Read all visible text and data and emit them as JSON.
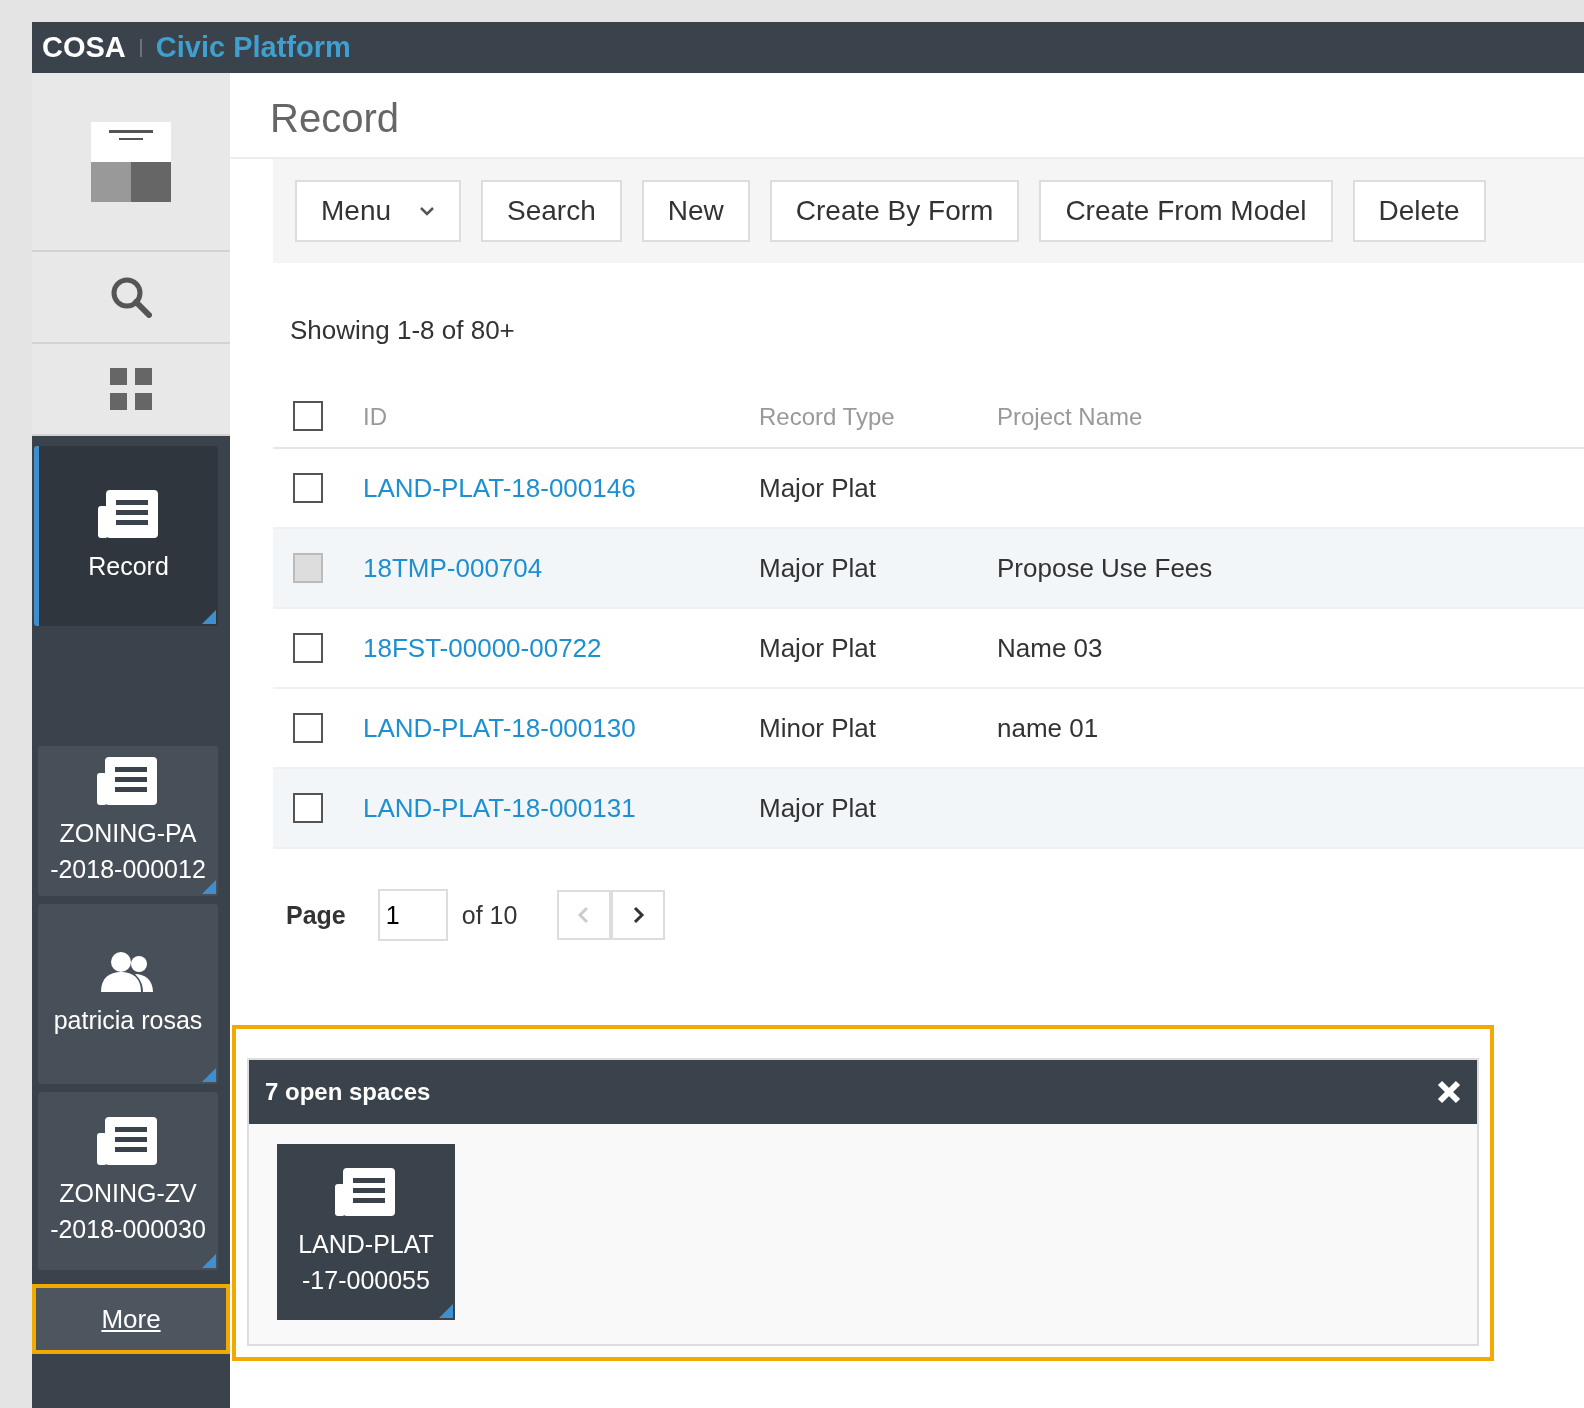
{
  "header": {
    "brand": "COSA",
    "product": "Civic Platform"
  },
  "sidebar": {
    "nav": [
      {
        "kind": "logo"
      },
      {
        "kind": "search"
      },
      {
        "kind": "apps"
      }
    ],
    "spaces": [
      {
        "label": "Record",
        "kind": "record",
        "selected": true
      },
      {
        "label": "ZONING-PA -2018-000012",
        "kind": "record",
        "selected": false
      },
      {
        "label": "patricia rosas",
        "kind": "people",
        "selected": false
      },
      {
        "label": "ZONING-ZV -2018-000030",
        "kind": "record",
        "selected": false
      }
    ],
    "more_link": "More"
  },
  "main": {
    "title": "Record",
    "toolbar": [
      {
        "label": "Menu",
        "kind": "dropdown"
      },
      {
        "label": "Search",
        "kind": "button"
      },
      {
        "label": "New",
        "kind": "button"
      },
      {
        "label": "Create By Form",
        "kind": "button"
      },
      {
        "label": "Create From Model",
        "kind": "button"
      },
      {
        "label": "Delete",
        "kind": "button"
      }
    ],
    "summary": "Showing 1-8 of 80+",
    "select_all_checked": false,
    "columns": [
      "ID",
      "Record Type",
      "Project Name"
    ],
    "rows": [
      {
        "id": "LAND-PLAT-18-000146",
        "record_type": "Major Plat",
        "checked": false,
        "disabled": false
      },
      {
        "id": "18TMP-000704",
        "record_type": "Major Plat",
        "project_name": "Propose Use Fees",
        "checked": false,
        "disabled": true
      },
      {
        "id": "18FST-00000-00722",
        "record_type": "Major Plat",
        "project_name": "Name 03",
        "checked": false,
        "disabled": false
      },
      {
        "id": "LAND-PLAT-18-000130",
        "record_type": "Minor Plat",
        "project_name": "name 01",
        "checked": false,
        "disabled": false
      },
      {
        "id": "LAND-PLAT-18-000131",
        "record_type": "Major Plat",
        "checked": false,
        "disabled": false
      }
    ],
    "pagination": {
      "label": "Page",
      "value": "1",
      "total": "of 10",
      "prev_disabled": true,
      "next_disabled": false
    }
  },
  "open_spaces": {
    "title": "7 open spaces",
    "items": [
      {
        "label": "LAND-PLAT -17-000055",
        "kind": "record"
      }
    ]
  }
}
